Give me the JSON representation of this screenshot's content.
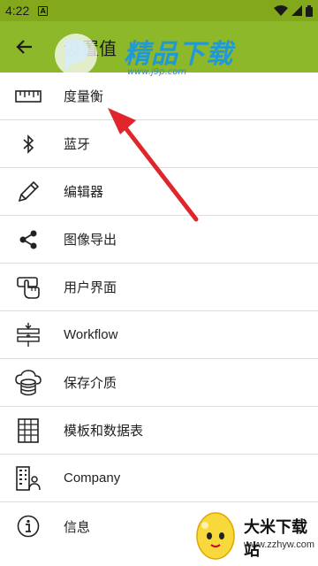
{
  "status_bar": {
    "time": "4:22",
    "notification_badge": "A"
  },
  "app_bar": {
    "title": "设置值",
    "back_icon": "arrow-left-icon"
  },
  "watermark": {
    "text": "精品下载",
    "url": "www.j9p.com"
  },
  "menu": [
    {
      "label": "度量衡",
      "icon": "ruler-icon"
    },
    {
      "label": "蓝牙",
      "icon": "bluetooth-icon"
    },
    {
      "label": "编辑器",
      "icon": "pencil-icon"
    },
    {
      "label": "图像导出",
      "icon": "share-icon"
    },
    {
      "label": "用户界面",
      "icon": "touch-screen-icon"
    },
    {
      "label": "Workflow",
      "icon": "workflow-icon"
    },
    {
      "label": "保存介质",
      "icon": "cloud-database-icon"
    },
    {
      "label": "模板和数据表",
      "icon": "grid-table-icon"
    },
    {
      "label": "Company",
      "icon": "company-building-icon"
    },
    {
      "label": "信息",
      "icon": "info-icon"
    }
  ],
  "bottom_watermark": {
    "title": "大米下载站",
    "url": "www.zzhyw.com"
  },
  "colors": {
    "app_bar": "#8db82a",
    "status_bar": "#83a81c",
    "arrow": "#e0262c",
    "divider": "#dddddd"
  }
}
